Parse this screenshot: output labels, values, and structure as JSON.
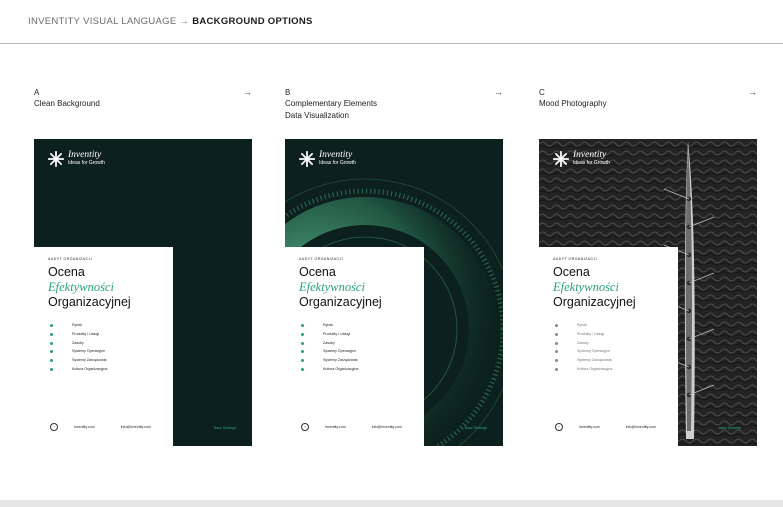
{
  "breadcrumb": {
    "section": "INVENTITY VISUAL LANGUAGE",
    "separator": "→",
    "page": "BACKGROUND OPTIONS"
  },
  "options": [
    {
      "letter": "A",
      "label_line1": "Clean Background",
      "label_line2": "",
      "arrow": "→"
    },
    {
      "letter": "B",
      "label_line1": "Complementary Elements",
      "label_line2": "Data Visualization",
      "arrow": "→"
    },
    {
      "letter": "C",
      "label_line1": "Mood Photography",
      "label_line2": "",
      "arrow": "→"
    }
  ],
  "brand": {
    "name": "Inventity",
    "tagline": "Ideas for Growth"
  },
  "doc": {
    "kicker": "AUDYT ORGANIZACJI",
    "title_line1": "Ocena",
    "title_line2": "Efektywności",
    "title_line3": "Organizacyjnej",
    "items": [
      "Rynek",
      "Produkty / Usługi",
      "Zasoby",
      "Systemy Operacyjne",
      "Systemy Zarządzania",
      "Kultura Organizacyjna"
    ],
    "footer_arrow": "›",
    "site": "inventity.com",
    "email": "info@inventity.com",
    "footer_right": "Nasz Strategii"
  },
  "colors": {
    "card_dark": "#0c211d",
    "accent_green": "#2aa276",
    "header_rule": "#bfbfbf"
  }
}
